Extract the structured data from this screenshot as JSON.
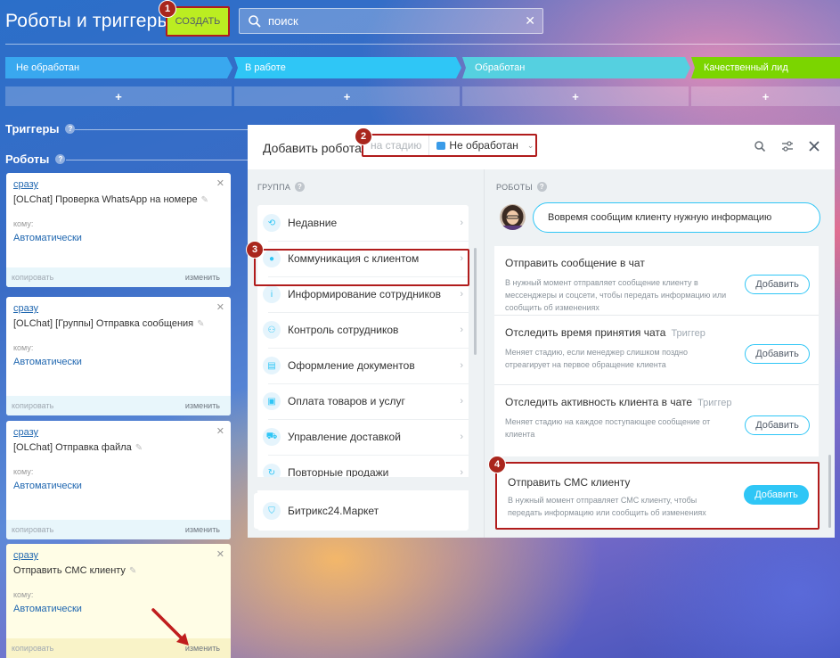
{
  "header": {
    "title": "Роботы и триггеры",
    "create_label": "СОЗДАТЬ",
    "search_placeholder": "поиск"
  },
  "stages": [
    {
      "label": "Не обработан",
      "color": "#39a8ef"
    },
    {
      "label": "В работе",
      "color": "#2fc6f6"
    },
    {
      "label": "Обработан",
      "color": "#55d0e0"
    },
    {
      "label": "Качественный лид",
      "color": "#7bd500"
    }
  ],
  "add_symbol": "+",
  "sections": {
    "triggers": "Триггеры",
    "robots": "Роботы",
    "help": "?"
  },
  "robot_cards": [
    {
      "when": "сразу",
      "name": "[OLChat] Проверка WhatsApp на номере",
      "to_label": "кому:",
      "to_value": "Автоматически",
      "copy": "копировать",
      "edit": "изменить"
    },
    {
      "when": "сразу",
      "name": "[OLChat] [Группы] Отправка сообщения",
      "to_label": "кому:",
      "to_value": "Автоматически",
      "copy": "копировать",
      "edit": "изменить"
    },
    {
      "when": "сразу",
      "name": "[OLChat] Отправка файла",
      "to_label": "кому:",
      "to_value": "Автоматически",
      "copy": "копировать",
      "edit": "изменить"
    },
    {
      "when": "сразу",
      "name": "Отправить СМС клиенту",
      "to_label": "кому:",
      "to_value": "Автоматически",
      "copy": "копировать",
      "edit": "изменить"
    }
  ],
  "badges": [
    "1",
    "2",
    "3",
    "4"
  ],
  "dialog": {
    "title": "Добавить робота",
    "stage_label": "на стадию",
    "stage_value": "Не обработан",
    "group_header": "ГРУППА",
    "robots_header": "РОБОТЫ",
    "tip": "Вовремя сообщим клиенту нужную информацию",
    "groups": [
      {
        "label": "Недавние",
        "icon": "history-icon"
      },
      {
        "label": "Коммуникация с клиентом",
        "icon": "chat-icon"
      },
      {
        "label": "Информирование сотрудников",
        "icon": "info-icon"
      },
      {
        "label": "Контроль сотрудников",
        "icon": "people-icon"
      },
      {
        "label": "Оформление документов",
        "icon": "document-icon"
      },
      {
        "label": "Оплата товаров и услуг",
        "icon": "wallet-icon"
      },
      {
        "label": "Управление доставкой",
        "icon": "truck-icon"
      },
      {
        "label": "Повторные продажи",
        "icon": "repeat-icon"
      }
    ],
    "market": "Битрикс24.Маркет",
    "robots": [
      {
        "title": "Отправить сообщение в чат",
        "tag": "",
        "desc": "В нужный момент отправляет сообщение клиенту в мессенджеры и соцсети, чтобы передать информацию или сообщить об изменениях",
        "button": "Добавить"
      },
      {
        "title": "Отследить время принятия чата",
        "tag": "Триггер",
        "desc": "Меняет стадию, если менеджер слишком поздно отреагирует на первое обращение клиента",
        "button": "Добавить"
      },
      {
        "title": "Отследить активность клиента в чате",
        "tag": "Триггер",
        "desc": "Меняет стадию на каждое поступающее сообщение от клиента",
        "button": "Добавить"
      },
      {
        "title": "Отправить СМС клиенту",
        "tag": "",
        "desc": "В нужный момент отправляет СМС клиенту, чтобы передать информацию или сообщить об изменениях",
        "button": "Добавить"
      }
    ]
  }
}
